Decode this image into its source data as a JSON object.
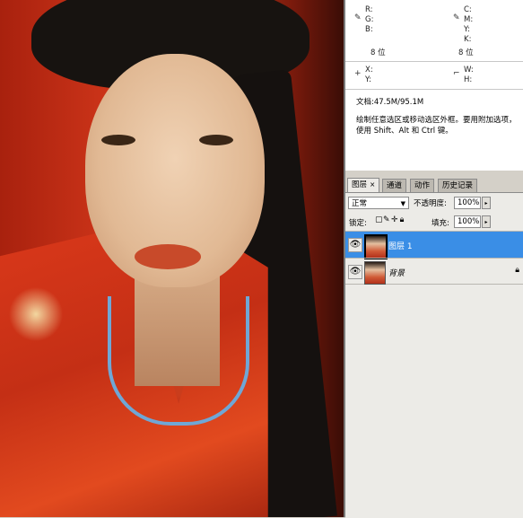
{
  "info_panel": {
    "rgb": {
      "r": "R:",
      "g": "G:",
      "b": "B:"
    },
    "cmyk": {
      "c": "C:",
      "m": "M:",
      "y": "Y:",
      "k": "K:"
    },
    "bits_left": "8 位",
    "bits_right": "8 位",
    "xy": {
      "x": "X:",
      "y": "Y:"
    },
    "wh": {
      "w": "W:",
      "h": "H:"
    },
    "doc": "文档:47.5M/95.1M",
    "hint": "绘制任意选区或移动选区外框。要用附加选项，使用 Shift、Alt 和 Ctrl 键。"
  },
  "layers_panel": {
    "tabs": [
      {
        "label": "图层",
        "close": "×"
      },
      {
        "label": "通道"
      },
      {
        "label": "动作"
      },
      {
        "label": "历史记录"
      }
    ],
    "blend_mode": "正常",
    "opacity_label": "不透明度:",
    "opacity_value": "100%",
    "lock_label": "锁定:",
    "fill_label": "填充:",
    "fill_value": "100%",
    "layers": [
      {
        "name": "图层 1",
        "selected": true
      },
      {
        "name": "背景",
        "locked": true
      }
    ]
  },
  "colors": {
    "selection": "#3a8ee6",
    "panel_bg": "#d4d0c8"
  }
}
